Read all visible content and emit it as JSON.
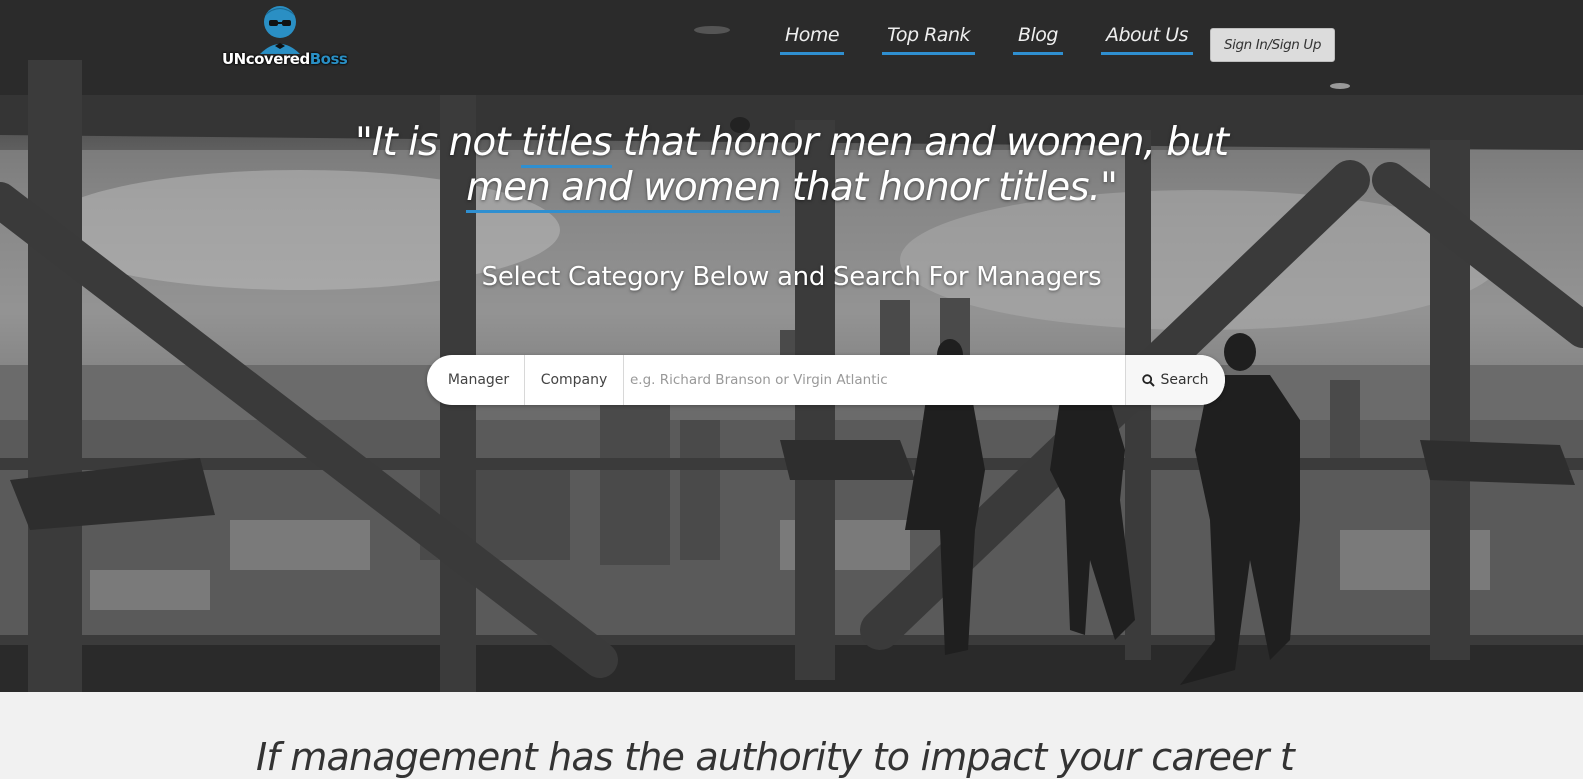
{
  "brand": {
    "logo_part1": "UNcovered",
    "logo_part2": "Boss",
    "accent_color": "#2a8fc4"
  },
  "nav": {
    "items": [
      {
        "label": "Home"
      },
      {
        "label": "Top Rank"
      },
      {
        "label": "Blog"
      },
      {
        "label": "About Us"
      }
    ],
    "signin_label": "Sign In/Sign Up"
  },
  "hero": {
    "quote_open": "\"It is not ",
    "quote_u1": "titles",
    "quote_mid": " that honor men and women, but",
    "quote_u2": "men and women",
    "quote_end": " that honor titles.\"",
    "subtitle": "Select Category Below and Search For Managers"
  },
  "search": {
    "category_manager": "Manager",
    "category_company": "Company",
    "placeholder": "e.g. Richard Branson or Virgin Atlantic",
    "button_label": "Search",
    "icon": "search-icon"
  },
  "below": {
    "tagline": "If management has the authority to impact your career t"
  }
}
